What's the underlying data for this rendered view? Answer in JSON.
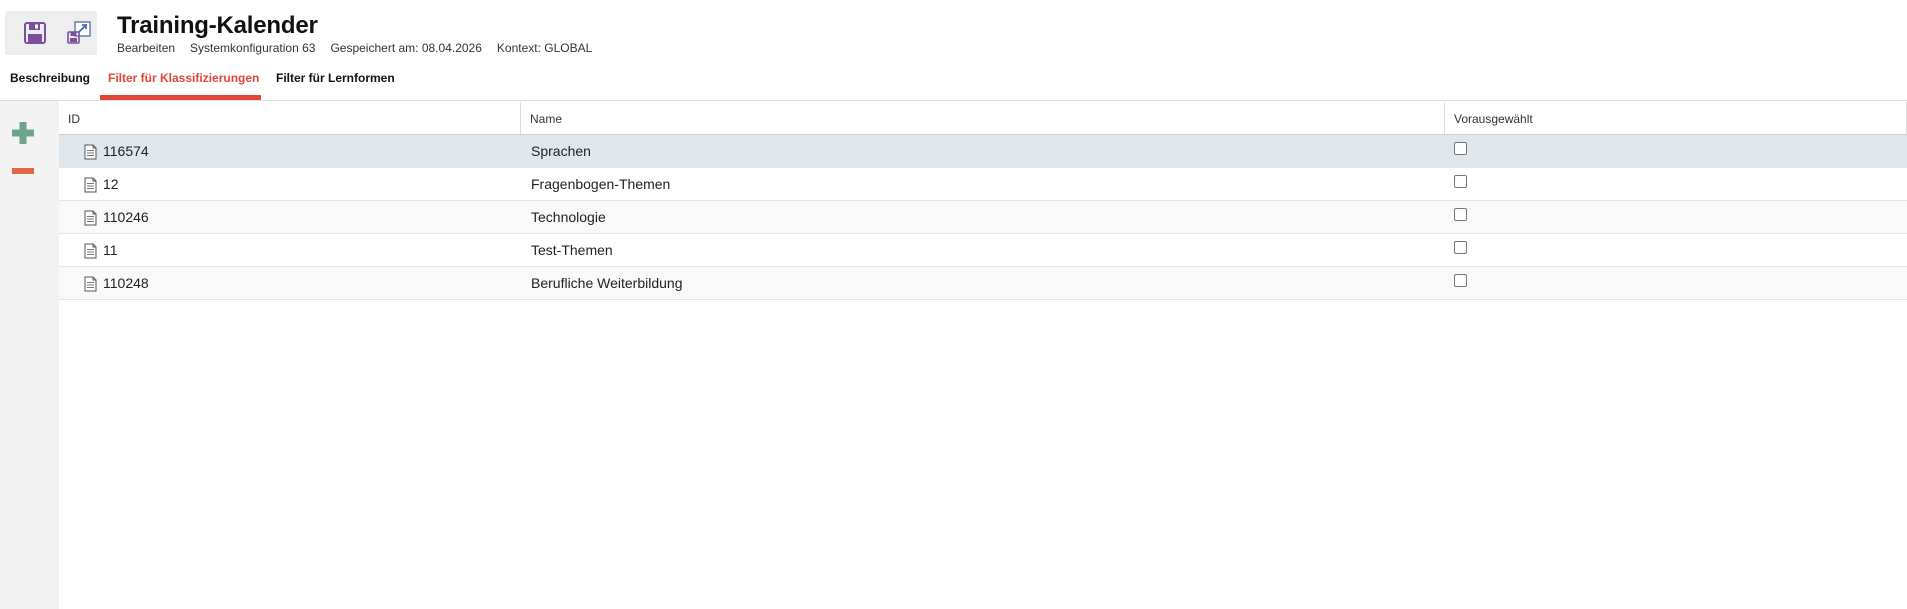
{
  "header": {
    "title": "Training-Kalender",
    "meta": {
      "mode": "Bearbeiten",
      "config": "Systemkonfiguration 63",
      "saved": "Gespeichert am: 08.04.2026",
      "context": "Kontext: GLOBAL"
    },
    "toolbar": {
      "save_icon": "floppy-disk-icon",
      "save_as_icon": "save-export-icon"
    }
  },
  "tabs": [
    {
      "label": "Beschreibung",
      "active": false
    },
    {
      "label": "Filter für Klassifizierungen",
      "active": true
    },
    {
      "label": "Filter für Lernformen",
      "active": false
    }
  ],
  "rail": {
    "add_icon": "plus-icon",
    "remove_icon": "minus-icon"
  },
  "colors": {
    "accent": "#e0463a",
    "add_green": "#6aa58c",
    "remove_red": "#e06748",
    "toolbar_purple": "#7b4fa0",
    "selected_row": "#dfe7ec"
  },
  "table": {
    "columns": [
      "ID",
      "Name",
      "Vorausgewählt"
    ],
    "rows": [
      {
        "id": "116574",
        "name": "Sprachen",
        "preselected": false,
        "selected": true
      },
      {
        "id": "12",
        "name": "Fragenbogen-Themen",
        "preselected": false,
        "selected": false
      },
      {
        "id": "110246",
        "name": "Technologie",
        "preselected": false,
        "selected": false
      },
      {
        "id": "11",
        "name": "Test-Themen",
        "preselected": false,
        "selected": false
      },
      {
        "id": "110248",
        "name": "Berufliche Weiterbildung",
        "preselected": false,
        "selected": false
      }
    ]
  }
}
